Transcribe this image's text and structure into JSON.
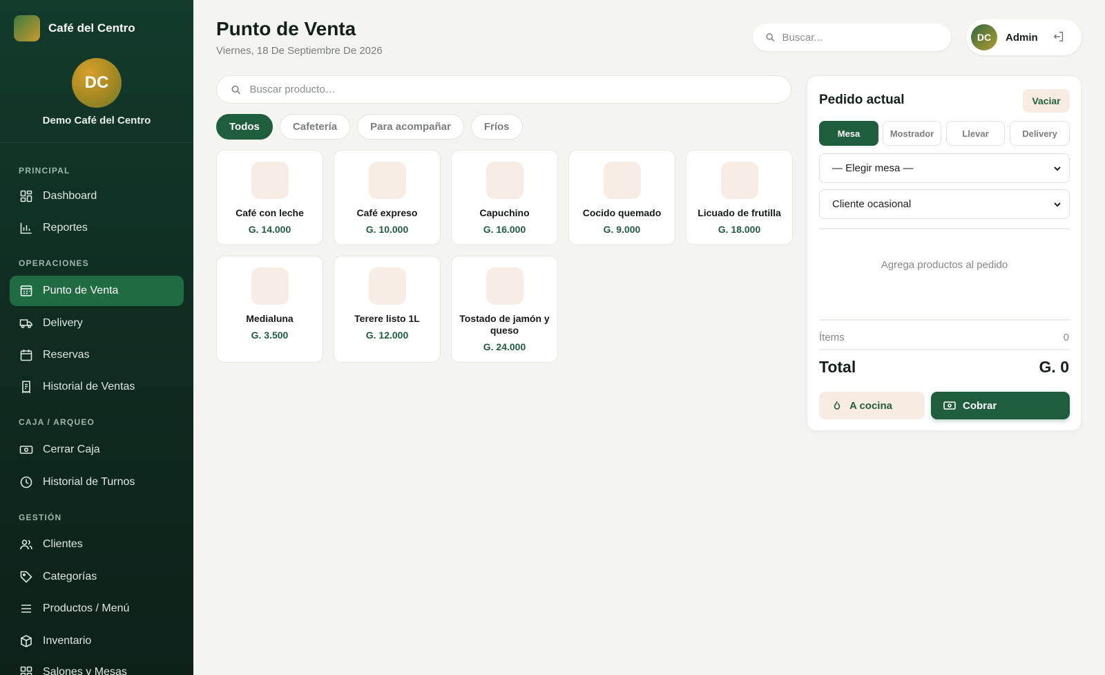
{
  "colors": {
    "sidebar": "#123b2c",
    "accent": "#1f5e3d",
    "active_nav": "#1f6b42",
    "thumb": "#f7ede4",
    "soft_button": "#f8ece2"
  },
  "brand": {
    "name": "Café del Centro"
  },
  "profile": {
    "initials": "DC",
    "name": "Demo Café del Centro"
  },
  "nav": {
    "sections": [
      {
        "title": "PRINCIPAL",
        "items": [
          {
            "label": "Dashboard",
            "icon": "dashboard-icon"
          },
          {
            "label": "Reportes",
            "icon": "bar-chart-icon"
          }
        ]
      },
      {
        "title": "OPERACIONES",
        "items": [
          {
            "label": "Punto de Venta",
            "icon": "pos-icon",
            "active": true
          },
          {
            "label": "Delivery",
            "icon": "truck-icon"
          },
          {
            "label": "Reservas",
            "icon": "calendar-icon"
          },
          {
            "label": "Historial de Ventas",
            "icon": "receipt-icon"
          }
        ]
      },
      {
        "title": "CAJA / ARQUEO",
        "items": [
          {
            "label": "Cerrar Caja",
            "icon": "cash-icon"
          },
          {
            "label": "Historial de Turnos",
            "icon": "clock-icon"
          }
        ]
      },
      {
        "title": "GESTIÓN",
        "items": [
          {
            "label": "Clientes",
            "icon": "users-icon"
          },
          {
            "label": "Categorías",
            "icon": "tag-icon"
          },
          {
            "label": "Productos / Menú",
            "icon": "menu-icon"
          },
          {
            "label": "Inventario",
            "icon": "box-icon"
          },
          {
            "label": "Salones y Mesas",
            "icon": "tables-icon"
          }
        ]
      }
    ]
  },
  "header": {
    "title": "Punto de Venta",
    "date": "Viernes, 18 De Septiembre De 2026",
    "search_placeholder": "Buscar...",
    "user_initials": "DC",
    "user_name": "Admin"
  },
  "products": {
    "search_placeholder": "Buscar producto…",
    "categories": [
      {
        "label": "Todos",
        "active": true
      },
      {
        "label": "Cafetería",
        "active": false
      },
      {
        "label": "Para acompañar",
        "active": false
      },
      {
        "label": "Fríos",
        "active": false
      }
    ],
    "items": [
      {
        "name": "Café con leche",
        "price": "G. 14.000"
      },
      {
        "name": "Café expreso",
        "price": "G. 10.000"
      },
      {
        "name": "Capuchino",
        "price": "G. 16.000"
      },
      {
        "name": "Cocido quemado",
        "price": "G. 9.000"
      },
      {
        "name": "Licuado de frutilla",
        "price": "G. 18.000"
      },
      {
        "name": "Medialuna",
        "price": "G. 3.500"
      },
      {
        "name": "Terere listo 1L",
        "price": "G. 12.000"
      },
      {
        "name": "Tostado de jamón y queso",
        "price": "G. 24.000"
      }
    ]
  },
  "order": {
    "title": "Pedido actual",
    "clear_label": "Vaciar",
    "types": [
      {
        "label": "Mesa",
        "active": true
      },
      {
        "label": "Mostrador",
        "active": false
      },
      {
        "label": "Llevar",
        "active": false
      },
      {
        "label": "Delivery",
        "active": false
      }
    ],
    "table_select": "— Elegir mesa —",
    "client_select": "Cliente ocasional",
    "empty_message": "Agrega productos al pedido",
    "items_label": "Ítems",
    "items_count": "0",
    "total_label": "Total",
    "total_value": "G. 0",
    "kitchen_label": "A cocina",
    "pay_label": "Cobrar"
  }
}
